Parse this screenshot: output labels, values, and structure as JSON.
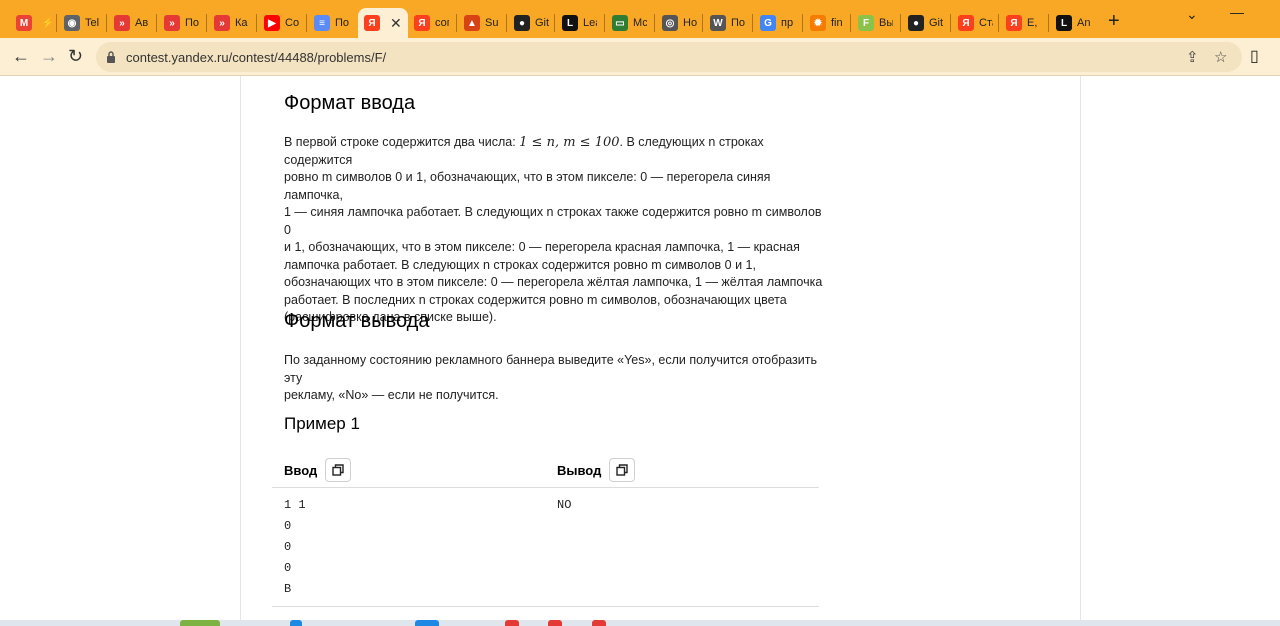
{
  "tabs": [
    {
      "title": "",
      "icon": "gmail-icon",
      "color": "#ea4335",
      "glyph": "M"
    },
    {
      "title": "",
      "icon": "bolt-icon",
      "color": "#f9a825",
      "glyph": "⚡"
    },
    {
      "title": "Tel",
      "icon": "globe-icon",
      "color": "#5f6368",
      "glyph": "◉"
    },
    {
      "title": "Ав",
      "icon": "yandex-praktikum-icon",
      "color": "#e53935",
      "glyph": "»"
    },
    {
      "title": "По",
      "icon": "yandex-praktikum-icon",
      "color": "#e53935",
      "glyph": "»"
    },
    {
      "title": "Ка",
      "icon": "yandex-praktikum-icon",
      "color": "#e53935",
      "glyph": "»"
    },
    {
      "title": "Со",
      "icon": "youtube-icon",
      "color": "#ff0000",
      "glyph": "▶"
    },
    {
      "title": "По",
      "icon": "doc-icon",
      "color": "#5c8bf5",
      "glyph": "≡"
    },
    {
      "title": "",
      "icon": "yandex-icon",
      "color": "#fc3f1d",
      "glyph": "Я"
    },
    {
      "title": "сог",
      "icon": "yandex-icon",
      "color": "#fc3f1d",
      "glyph": "Я"
    },
    {
      "title": "Sur",
      "icon": "sunset-icon",
      "color": "#d84315",
      "glyph": "▲"
    },
    {
      "title": "Git",
      "icon": "github-icon",
      "color": "#222222",
      "glyph": "●"
    },
    {
      "title": "Lea",
      "icon": "leetcode-icon",
      "color": "#111111",
      "glyph": "L"
    },
    {
      "title": "Мс",
      "icon": "monitor-icon",
      "color": "#2e7d32",
      "glyph": "▭"
    },
    {
      "title": "Но",
      "icon": "chrome-icon",
      "color": "#555555",
      "glyph": "◎"
    },
    {
      "title": "По",
      "icon": "wordpress-icon",
      "color": "#555555",
      "glyph": "W"
    },
    {
      "title": "пр",
      "icon": "google-icon",
      "color": "#4285f4",
      "glyph": "G"
    },
    {
      "title": "fin",
      "icon": "sun-icon",
      "color": "#f57c00",
      "glyph": "✹"
    },
    {
      "title": "Вы",
      "icon": "notes-icon",
      "color": "#8bc34a",
      "glyph": "F"
    },
    {
      "title": "Git",
      "icon": "github-icon",
      "color": "#222222",
      "glyph": "●"
    },
    {
      "title": "Ста",
      "icon": "yandex-icon",
      "color": "#fc3f1d",
      "glyph": "Я"
    },
    {
      "title": "E, (",
      "icon": "yandex-icon",
      "color": "#fc3f1d",
      "glyph": "Я"
    },
    {
      "title": "An",
      "icon": "leetcode-icon",
      "color": "#111111",
      "glyph": "L"
    }
  ],
  "address": {
    "url": "contest.yandex.ru/contest/44488/problems/F/"
  },
  "input_section": {
    "title": "Формат ввода",
    "p1_before": "В первой строке содержится два числа: ",
    "math": "1 ≤ n, m ≤ 100",
    "p1_after": ". В следующих n строках содержится",
    "lines": [
      "ровно m символов 0 и 1, обозначающих, что в этом пикселе: 0 — перегорела синяя лампочка,",
      "1 — синяя лампочка работает. В следующих n строках также содержится ровно m символов 0",
      "и 1, обозначающих, что в этом пикселе: 0 — перегорела красная лампочка, 1 — красная",
      "лампочка работает. В следующих n строках содержится ровно m символов 0 и 1,",
      "обозначающих что в этом пикселе: 0 — перегорела жёлтая лампочка, 1 — жёлтая лампочка",
      "работает. В последних n строках содержится ровно m символов, обозначающих цвета",
      "(расшифровка дана в списке выше)."
    ]
  },
  "output_section": {
    "title": "Формат вывода",
    "lines": [
      "По заданному состоянию рекламного баннера выведите «Yes», если получится отобразить эту",
      "рекламу, «No» — если не получится."
    ]
  },
  "example": {
    "title": "Пример 1",
    "input_label": "Ввод",
    "output_label": "Вывод",
    "input_lines": [
      "1 1",
      "0",
      "0",
      "0",
      "B"
    ],
    "output_lines": [
      "NO"
    ]
  }
}
